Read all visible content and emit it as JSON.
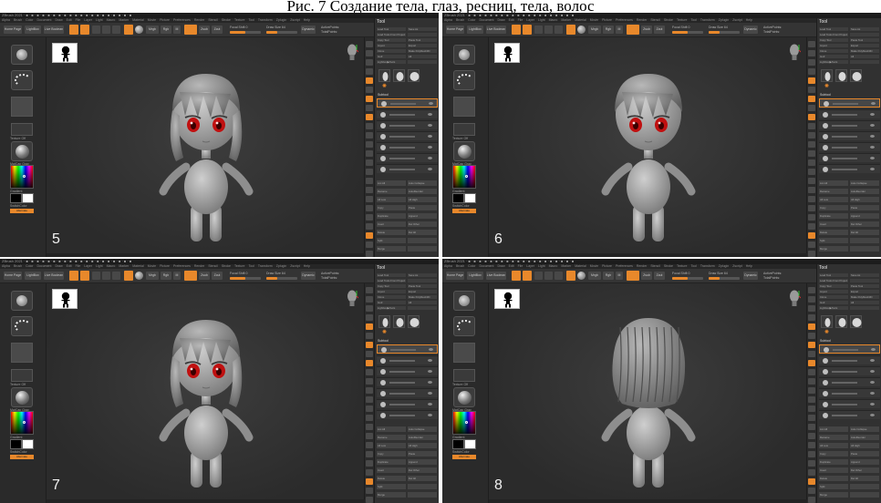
{
  "caption": "Рис. 7 Создание тела, глаз, ресниц, тела, волос",
  "app": {
    "menu": [
      "Alpha",
      "Brush",
      "Color",
      "Document",
      "Draw",
      "Edit",
      "File",
      "Layer",
      "Light",
      "Macro",
      "Marker",
      "Material",
      "Movie",
      "Picture",
      "Preferences",
      "Render",
      "Stencil",
      "Stroke",
      "Texture",
      "Tool",
      "Transform",
      "Zplugin",
      "Zscript",
      "Help"
    ],
    "toolbar": {
      "home_page": "Home Page",
      "lightbox": "LightBox",
      "live_boolean": "Live Boolean",
      "mrgb": "Mrgb",
      "rgb": "Rgb",
      "m": "M",
      "zadd": "Zadd",
      "zsub": "Zsub",
      "zcut": "Zcut",
      "focal_shift": "Focal Shift 0",
      "draw_size": "Draw Size 64",
      "dynamic": "Dynamic",
      "active_points": "ActivePoints:",
      "total_points": "TotalPoints:"
    },
    "left_shelf": {
      "texture_off": "Texture Off",
      "material": "MatCap Gray",
      "gradient": "Gradient",
      "switch_color": "SwitchColor",
      "alternate": "Alternate"
    },
    "tool_panel": {
      "title": "Tool",
      "rows": [
        [
          "Load Tool",
          "Save As"
        ],
        [
          "Load Tools From Project",
          ""
        ],
        [
          "Copy Tool",
          "Paste Tool"
        ],
        [
          "Import",
          "Export"
        ],
        [
          "Clone",
          "Make PolyMesh3D"
        ],
        [
          "GoZ",
          "All",
          "Visible",
          "R"
        ],
        [
          "Lightbox▶Tools",
          ""
        ]
      ],
      "subtool_label": "Subtool",
      "bottom_rows": [
        [
          "List All",
          "Auto Collapse"
        ],
        [
          "Rename",
          "AutoReorder"
        ],
        [
          "All Low",
          "All High"
        ],
        [
          "Copy",
          "Paste"
        ],
        [
          "Duplicate",
          "Append"
        ],
        [
          "Insert",
          "Del Other"
        ],
        [
          "Delete",
          "Del All"
        ],
        [
          "Split",
          ""
        ],
        [
          "Merge",
          ""
        ]
      ]
    }
  },
  "panels": [
    {
      "frame": "5",
      "view": "front"
    },
    {
      "frame": "6",
      "view": "front-short-hair"
    },
    {
      "frame": "7",
      "view": "front-pose"
    },
    {
      "frame": "8",
      "view": "back"
    }
  ],
  "colors": {
    "accent": "#e8882b",
    "eyes": "#c01010",
    "viewport": "#333333"
  }
}
